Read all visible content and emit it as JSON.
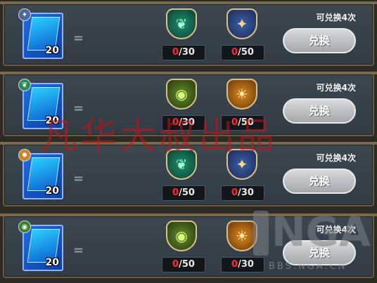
{
  "rows": [
    {
      "badge_icon": "sparkle-icon",
      "card_count": "20",
      "equals": "=",
      "items": [
        {
          "icon": "green-leaf-emblem-icon",
          "cost_have": "0",
          "cost_need": "/30"
        },
        {
          "icon": "blue-star-emblem-icon",
          "cost_have": "0",
          "cost_need": "/50"
        }
      ],
      "limit": "可兑换4次",
      "button": "兑换"
    },
    {
      "badge_icon": "green-leaf-icon",
      "card_count": "20",
      "equals": "=",
      "items": [
        {
          "icon": "green-eye-emblem-icon",
          "cost_have": "0",
          "cost_need": "/30"
        },
        {
          "icon": "gold-sun-emblem-icon",
          "cost_have": "0",
          "cost_need": "/50"
        }
      ],
      "limit": "可兑换4次",
      "button": "兑换"
    },
    {
      "badge_icon": "gold-gear-icon",
      "card_count": "20",
      "equals": "=",
      "items": [
        {
          "icon": "green-leaf-emblem-icon",
          "cost_have": "0",
          "cost_need": "/50"
        },
        {
          "icon": "blue-star-emblem-icon",
          "cost_have": "0",
          "cost_need": "/30"
        }
      ],
      "limit": "可兑换4次",
      "button": "兑换"
    },
    {
      "badge_icon": "green-eye-icon",
      "card_count": "20",
      "equals": "=",
      "items": [
        {
          "icon": "green-eye-emblem-icon",
          "cost_have": "0",
          "cost_need": "/50"
        },
        {
          "icon": "gold-sun-emblem-icon",
          "cost_have": "0",
          "cost_need": "/30"
        }
      ],
      "limit": "可兑换4次",
      "button": "兑换"
    }
  ],
  "watermark": {
    "text": "凡华大叔出品",
    "logo": "NGA",
    "url": "BBS.NGA.CN"
  },
  "colors": {
    "cost_have": "#ff2c2c",
    "panel": "#3a434c",
    "button": "#c4c7c9",
    "watermark": "#c0151b"
  }
}
